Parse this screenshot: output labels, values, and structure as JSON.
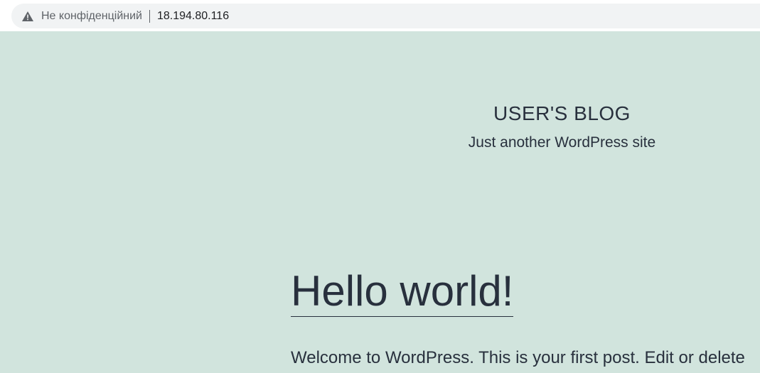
{
  "browser": {
    "security_label": "Не конфіденційний",
    "url": "18.194.80.116",
    "icon": "warning-triangle-icon"
  },
  "site": {
    "title": "USER'S BLOG",
    "description": "Just another WordPress site",
    "background_color": "#d1e4dd",
    "text_color": "#28303d"
  },
  "post": {
    "title": "Hello world!",
    "excerpt": "Welcome to WordPress. This is your first post. Edit or delete"
  }
}
